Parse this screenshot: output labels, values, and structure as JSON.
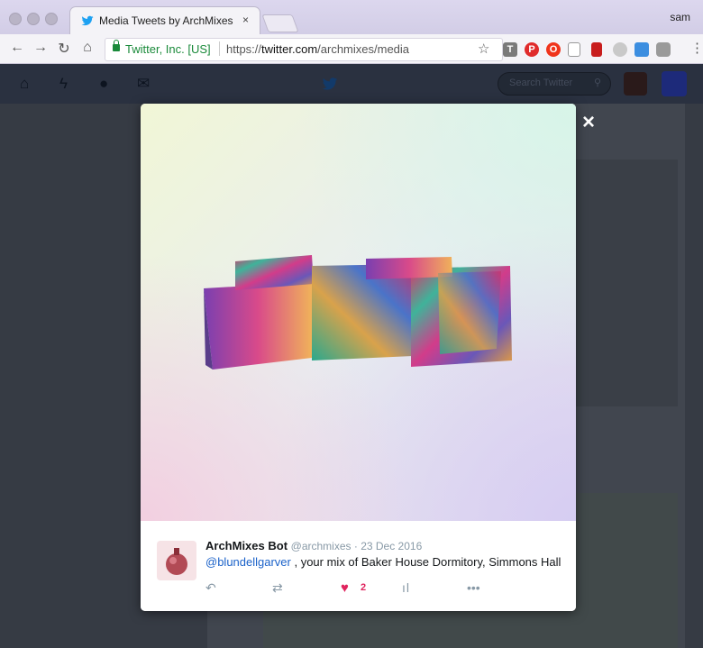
{
  "browser": {
    "tab_title": "Media Tweets by ArchMixes Bot",
    "tab_close": "×",
    "profile_name": "sam",
    "secure_label": "Twitter, Inc. [US]",
    "url_prefix": "https://",
    "url_host": "twitter.com",
    "url_path": "/archmixes/media"
  },
  "twitter_nav": {
    "search_placeholder": "Search Twitter"
  },
  "modal": {
    "close_label": "×",
    "author_name": "ArchMixes Bot",
    "author_handle": "@archmixes",
    "separator": " · ",
    "date": "23 Dec 2016",
    "mention": "@blundellgarver",
    "tweet_text": " , your mix of Baker House Dormitory, Simmons Hall",
    "like_count": "2"
  },
  "colors": {
    "twitter_blue": "#1da1f2",
    "like_red": "#e0245e",
    "secure_green": "#1a8a3a"
  }
}
